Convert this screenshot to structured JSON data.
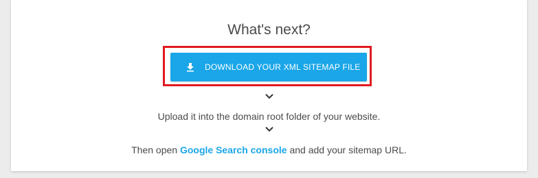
{
  "heading": "What's next?",
  "download_button": {
    "label": "DOWNLOAD YOUR XML SITEMAP FILE",
    "icon": "download-icon"
  },
  "steps": {
    "upload_text": "Upload it into the domain root folder of your website.",
    "open_prefix": "Then open",
    "console_link": "Google Search console",
    "open_suffix": "and add your sitemap URL."
  },
  "colors": {
    "accent": "#1aa6e8",
    "highlight": "#e0191f",
    "text": "#4a4a4a"
  }
}
